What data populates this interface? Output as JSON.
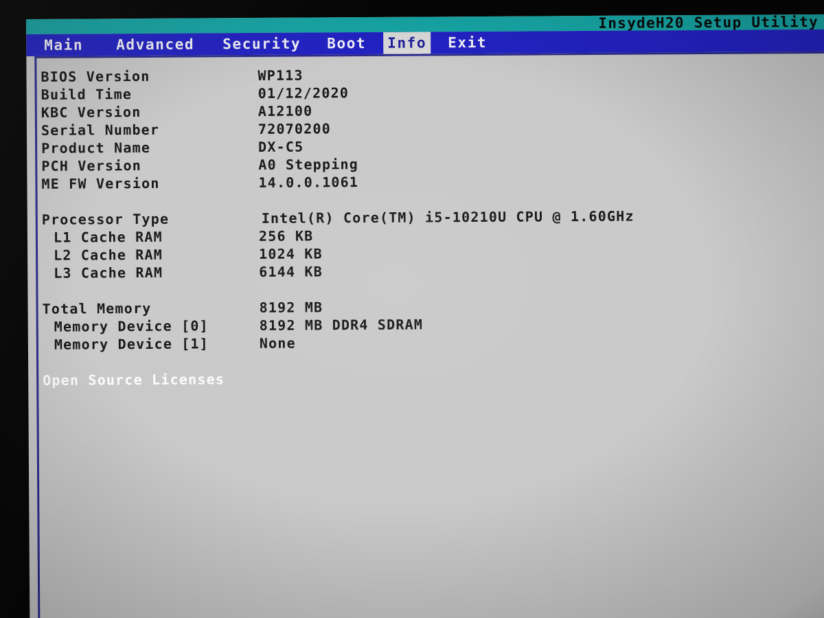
{
  "title": "InsydeH20 Setup Utility",
  "menu": {
    "items": [
      {
        "label": "Main",
        "active": false
      },
      {
        "label": "Advanced",
        "active": false
      },
      {
        "label": "Security",
        "active": false
      },
      {
        "label": "Boot",
        "active": false
      },
      {
        "label": "Info",
        "active": true
      },
      {
        "label": "Exit",
        "active": false
      }
    ]
  },
  "info": {
    "rows": [
      {
        "label": "BIOS Version",
        "value": "WP113"
      },
      {
        "label": "Build Time",
        "value": "01/12/2020"
      },
      {
        "label": "KBC Version",
        "value": "A12100"
      },
      {
        "label": "Serial Number",
        "value": "72070200"
      },
      {
        "label": "Product Name",
        "value": "DX-C5"
      },
      {
        "label": "PCH Version",
        "value": "A0 Stepping"
      },
      {
        "label": "ME FW Version",
        "value": "14.0.0.1061"
      },
      {
        "spacer": true
      },
      {
        "label": "Processor Type",
        "value": "Intel(R) Core(TM) i5-10210U CPU @ 1.60GHz"
      },
      {
        "label": "L1 Cache RAM",
        "value": "256 KB",
        "indent": true
      },
      {
        "label": "L2 Cache RAM",
        "value": "1024 KB",
        "indent": true
      },
      {
        "label": "L3 Cache RAM",
        "value": "6144 KB",
        "indent": true
      },
      {
        "spacer": true
      },
      {
        "label": "Total Memory",
        "value": "8192 MB"
      },
      {
        "label": "Memory Device [0]",
        "value": "8192 MB DDR4 SDRAM",
        "indent": true
      },
      {
        "label": "Memory Device [1]",
        "value": "None",
        "indent": true
      },
      {
        "spacer": true
      },
      {
        "label": "Open Source Licenses",
        "value": "",
        "link": true
      }
    ]
  },
  "colors": {
    "title_bar": "#17a6a6",
    "menu_bar": "#2222c4",
    "menu_active_bg": "#dadada",
    "menu_active_fg": "#20209c",
    "panel_bg": "#c9c9c9",
    "panel_border": "#2b2b8e",
    "text": "#161616",
    "link_text": "#fdfdfd"
  }
}
